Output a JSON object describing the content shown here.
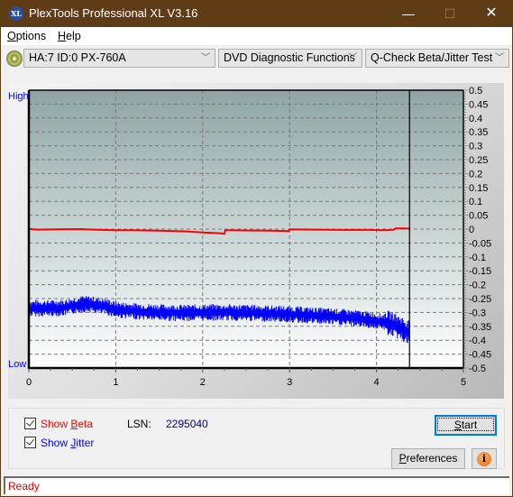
{
  "window": {
    "title": "PlexTools Professional XL V3.16",
    "app_icon_text": "XL",
    "minimize_glyph": "—",
    "maximize_glyph": "☐",
    "close_glyph": "✕"
  },
  "menu": {
    "items": [
      {
        "label_first": "O",
        "label_rest": "ptions"
      },
      {
        "label_first": "H",
        "label_rest": "elp"
      }
    ]
  },
  "toolbar": {
    "drive_select": "HA:7 ID:0  PX-760A",
    "function_select": "DVD Diagnostic Functions",
    "test_select": "Q-Check Beta/Jitter Test",
    "chevron_glyph": "﹀"
  },
  "chart_data": {
    "type": "line",
    "title": "",
    "xlabel": "",
    "ylabel_left_top": "High",
    "ylabel_left_bottom": "Low",
    "xlim": [
      0,
      5
    ],
    "ylim": [
      -0.5,
      0.5
    ],
    "x_ticks": [
      "0",
      "1",
      "2",
      "3",
      "4",
      "5"
    ],
    "y_ticks": [
      "0.5",
      "0.45",
      "0.4",
      "0.35",
      "0.3",
      "0.25",
      "0.2",
      "0.15",
      "0.1",
      "0.05",
      "0",
      "-0.05",
      "-0.1",
      "-0.15",
      "-0.2",
      "-0.25",
      "-0.3",
      "-0.35",
      "-0.4",
      "-0.45",
      "-0.5"
    ],
    "grid": true,
    "cursor_x": 4.38,
    "series": [
      {
        "name": "Beta",
        "color": "#ff0000",
        "x": [
          0.0,
          0.02,
          0.1,
          0.3,
          0.6,
          0.75,
          1.0,
          1.2,
          1.5,
          1.8,
          2.0,
          2.2,
          2.25,
          2.26,
          2.5,
          2.8,
          2.99,
          3.0,
          3.3,
          3.6,
          3.9,
          4.1,
          4.2,
          4.22,
          4.38
        ],
        "values": [
          0.005,
          0.0,
          -0.002,
          -0.001,
          0.0,
          -0.002,
          -0.004,
          -0.004,
          -0.006,
          -0.008,
          -0.012,
          -0.015,
          -0.017,
          -0.004,
          -0.005,
          -0.006,
          -0.007,
          -0.001,
          -0.002,
          -0.003,
          -0.003,
          -0.004,
          -0.002,
          0.003,
          0.002
        ]
      },
      {
        "name": "Jitter",
        "color": "#0000ff",
        "x": [
          0.0,
          0.2,
          0.4,
          0.6,
          0.7,
          0.9,
          1.0,
          1.2,
          1.5,
          1.8,
          2.0,
          2.3,
          2.6,
          2.9,
          3.2,
          3.5,
          3.8,
          4.0,
          4.1,
          4.2,
          4.3,
          4.38
        ],
        "values": [
          -0.285,
          -0.285,
          -0.283,
          -0.27,
          -0.27,
          -0.28,
          -0.29,
          -0.295,
          -0.3,
          -0.302,
          -0.3,
          -0.3,
          -0.302,
          -0.305,
          -0.31,
          -0.315,
          -0.322,
          -0.33,
          -0.335,
          -0.345,
          -0.36,
          -0.375
        ],
        "noise_amplitude": 0.03
      }
    ]
  },
  "controls": {
    "show_beta_label": {
      "before": "Show ",
      "accel": "B",
      "after": "eta"
    },
    "show_jitter_label": {
      "before": "Show ",
      "accel": "J",
      "after": "itter"
    },
    "show_beta_checked": true,
    "show_jitter_checked": true,
    "lsn_label": "LSN:",
    "lsn_value": "2295040",
    "start_label": {
      "accel": "S",
      "after": "tart"
    },
    "preferences_label": {
      "accel": "P",
      "after": "references"
    },
    "info_glyph": "i"
  },
  "status": {
    "text": "Ready"
  },
  "colors": {
    "titlebar": "#5f3c15",
    "beta": "#ff0000",
    "jitter": "#0000ff",
    "lsn_value": "#000080",
    "status_text": "#e00000",
    "axis_label": "#0000ff"
  }
}
